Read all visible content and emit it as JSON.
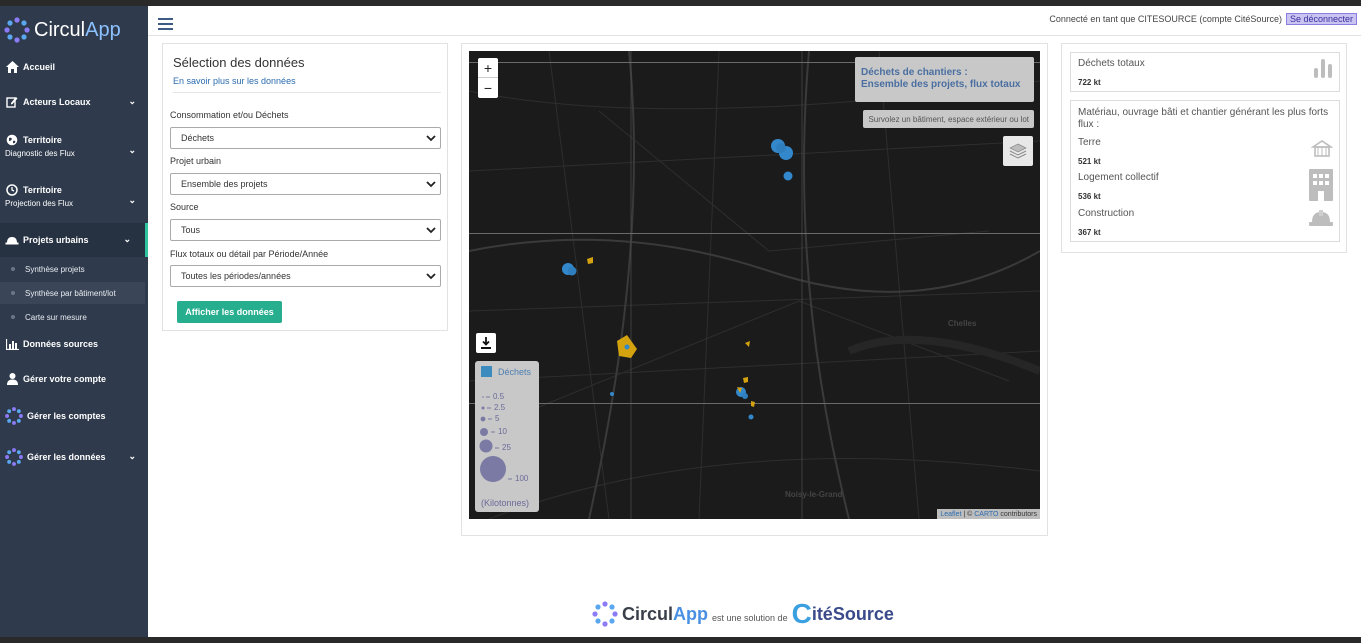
{
  "app": {
    "name_a": "Circul",
    "name_b": "App"
  },
  "sidebar": {
    "items": [
      {
        "label": "Accueil",
        "icon": "home-icon"
      },
      {
        "label": "Acteurs Locaux",
        "icon": "edit-icon"
      },
      {
        "label": "Territoire",
        "sub": "Diagnostic des Flux",
        "icon": "globe-icon"
      },
      {
        "label": "Territoire",
        "sub": "Projection des Flux",
        "icon": "clock-icon"
      },
      {
        "label": "Projets urbains",
        "icon": "hardhat-icon"
      },
      {
        "label": "Données sources",
        "icon": "bar-chart-icon"
      },
      {
        "label": "Gérer votre compte",
        "icon": "user-icon"
      },
      {
        "label": "Gérer les comptes",
        "icon": "circulapp-icon"
      },
      {
        "label": "Gérer les données",
        "icon": "circulapp-icon"
      }
    ],
    "subitems": [
      {
        "label": "Synthèse projets"
      },
      {
        "label": "Synthèse par bâtiment/lot"
      },
      {
        "label": "Carte sur mesure"
      }
    ]
  },
  "header": {
    "connected": "Connecté en tant que CITESOURCE (compte CitéSource)",
    "logout": "Se déconnecter"
  },
  "selection": {
    "title": "Sélection des données",
    "link": "En savoir plus sur les données",
    "fields": [
      {
        "label": "Consommation et/ou Déchets",
        "value": "Déchets"
      },
      {
        "label": "Projet urbain",
        "value": "Ensemble des projets"
      },
      {
        "label": "Source",
        "value": "Tous"
      },
      {
        "label": "Flux totaux ou détail par Période/Année",
        "value": "Toutes les périodes/années"
      }
    ],
    "button": "Afficher les données"
  },
  "map": {
    "zoom_in": "+",
    "zoom_out": "−",
    "title_line1": "Déchets de chantiers :",
    "title_line2": "Ensemble des projets, flux totaux",
    "hover_hint": "Survolez un bâtiment, espace extérieur ou lot",
    "place_labels": [
      "Chelles",
      "Noisy-le-Grand"
    ],
    "legend": {
      "title": "Déchets",
      "sizes": [
        "0.5",
        "2.5",
        "5",
        "10",
        "25",
        "100"
      ],
      "unit": "(Kilotonnes)"
    },
    "attribution": {
      "leaflet": "Leaflet",
      "sep": " | © ",
      "carto": "CARTO",
      "rest": " contributors"
    }
  },
  "stats": {
    "total_label": "Déchets totaux",
    "total_value": "722 kt",
    "top_title": "Matériau, ouvrage bâti et chantier générant les plus forts flux :",
    "top": [
      {
        "label": "Terre",
        "value": "521 kt",
        "icon": "earth-icon"
      },
      {
        "label": "Logement collectif",
        "value": "536 kt",
        "icon": "building-icon"
      },
      {
        "label": "Construction",
        "value": "367 kt",
        "icon": "hardhat-icon"
      }
    ]
  },
  "footer": {
    "brand_a": "Circul",
    "brand_b": "App",
    "sub": "est une solution de",
    "partner_a": "C",
    "partner_b": "itéSource"
  }
}
